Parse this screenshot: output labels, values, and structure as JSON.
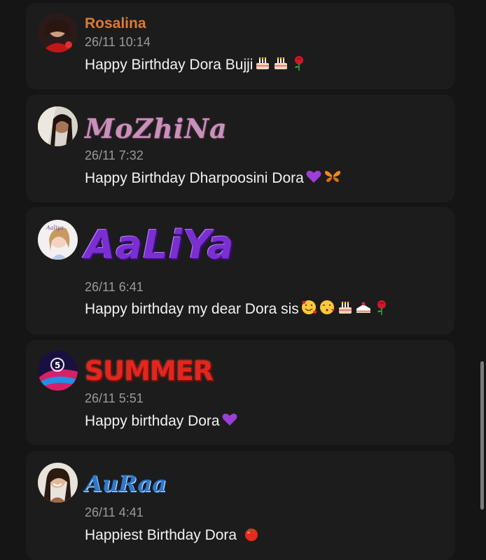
{
  "comments": [
    {
      "name": "Rosalina",
      "time": "26/11 10:14",
      "text": "Happy Birthday Dora Bujji",
      "emojis": [
        "birthday-cake-icon",
        "birthday-cake-icon",
        "rose-icon"
      ]
    },
    {
      "name": "MoZhiNa",
      "time": "26/11 7:32",
      "text": "Happy Birthday Dharpoosini Dora",
      "emojis": [
        "purple-heart-icon",
        "butterfly-icon"
      ]
    },
    {
      "name": "AaLiYa",
      "time": "26/11 6:41",
      "text": "Happy birthday my dear Dora sis",
      "emojis": [
        "smiling-face-hearts-icon",
        "face-blowing-kiss-icon",
        "birthday-cake-icon",
        "shortcake-icon",
        "rose-icon"
      ]
    },
    {
      "name": "SUMMER",
      "time": "26/11 5:51",
      "text": "Happy birthday Dora",
      "emojis": [
        "purple-heart-icon"
      ]
    },
    {
      "name": "AuRaa",
      "time": "26/11 4:41",
      "text": "Happiest Birthday Dora ",
      "emojis": [
        "tomato-icon"
      ]
    }
  ],
  "colors": {
    "background": "#151515",
    "card": "#1c1c1c",
    "timestamp": "#9a9a9a",
    "text": "#f2f2f2",
    "name_orange": "#e07a2e"
  }
}
